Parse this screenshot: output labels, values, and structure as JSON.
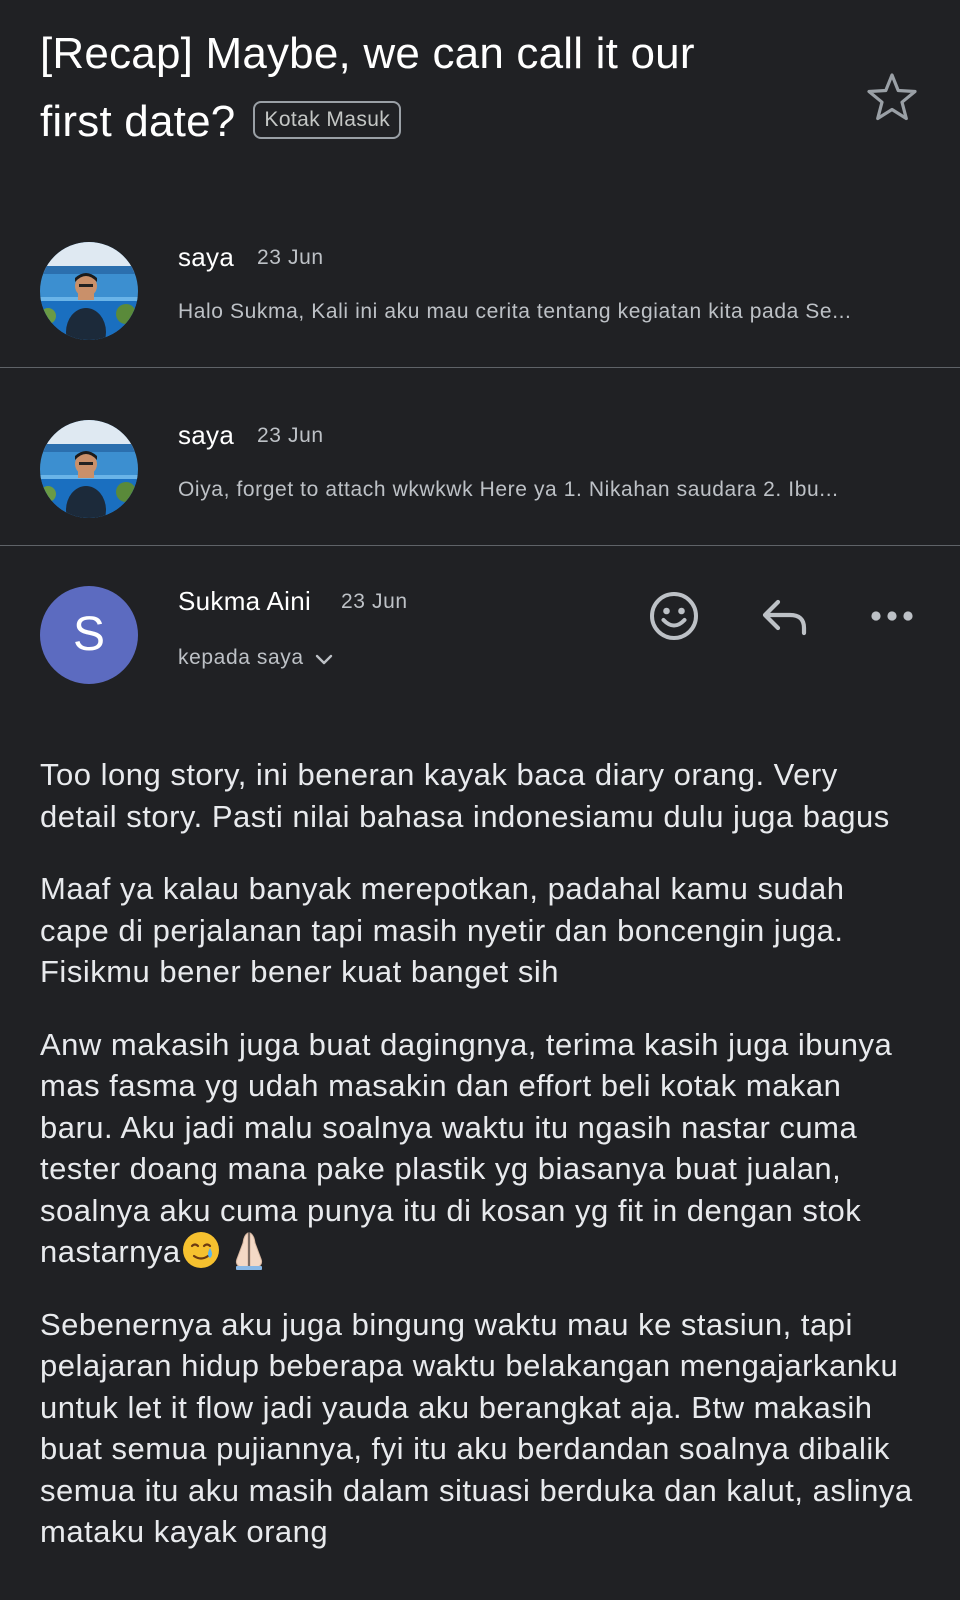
{
  "thread": {
    "subject_line1": "[Recap] Maybe, we can call it our",
    "subject_line2": "first date?",
    "label": "Kotak Masuk"
  },
  "messages": [
    {
      "sender": "saya",
      "date": "23 Jun",
      "snippet": "Halo Sukma, Kali ini aku mau cerita tentang kegiatan kita pada Se..."
    },
    {
      "sender": "saya",
      "date": "23 Jun",
      "snippet": "Oiya, forget to attach wkwkwk Here ya 1. Nikahan saudara 2. Ibu..."
    }
  ],
  "expanded": {
    "avatar_letter": "S",
    "sender": "Sukma Aini",
    "date": "23 Jun",
    "recipient": "kepada saya",
    "paragraphs": [
      "Too long story, ini beneran kayak baca diary orang. Very detail story. Pasti nilai bahasa indonesiamu dulu juga bagus",
      "Maaf ya kalau banyak merepotkan, padahal kamu sudah cape di perjalanan tapi masih nyetir dan boncengin juga. Fisikmu bener bener kuat banget sih",
      "Anw makasih juga buat dagingnya, terima kasih juga ibunya mas fasma yg udah masakin dan effort beli kotak makan baru. Aku jadi malu soalnya waktu itu ngasih nastar cuma tester doang mana pake plastik yg biasanya buat jualan, soalnya aku cuma punya itu di kosan yg fit in dengan stok nastarnya",
      "Sebenernya aku juga bingung waktu mau ke stasiun, tapi pelajaran hidup beberapa waktu belakangan mengajarkanku untuk let it flow jadi yauda aku berangkat aja. Btw makasih buat semua pujiannya, fyi itu aku berdandan soalnya dibalik semua itu aku masih dalam situasi berduka dan kalut, aslinya mataku kayak orang"
    ]
  },
  "icons": {
    "star": "star-outline-icon",
    "emoji": "add-reaction-icon",
    "reply": "reply-icon",
    "more": "more-horizontal-icon",
    "chevron": "chevron-down-icon",
    "tear_emoji": "smiling-face-with-tear-emoji",
    "pray_emoji": "folded-hands-emoji"
  },
  "colors": {
    "background": "#202124",
    "avatar_letter_bg": "#5c6bc0"
  }
}
